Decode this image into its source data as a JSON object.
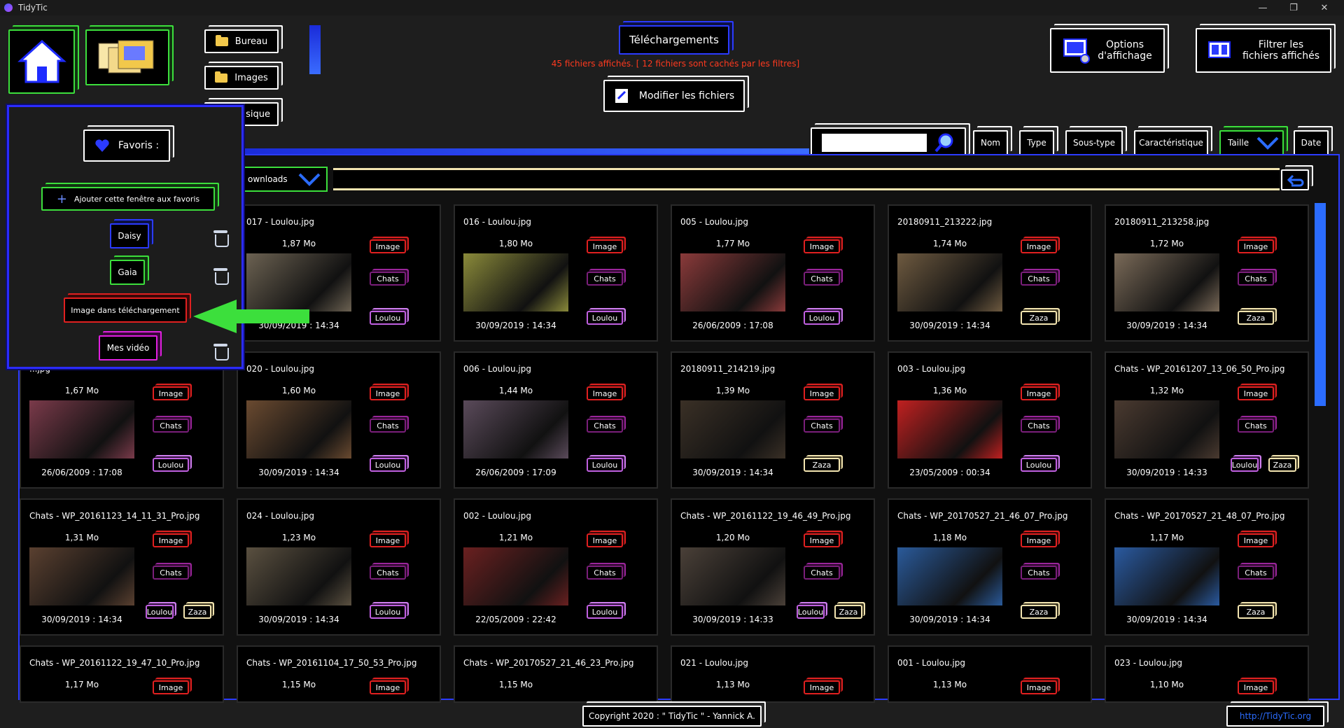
{
  "window": {
    "title": "TidyTic",
    "controls": [
      "—",
      "❐",
      "✕"
    ]
  },
  "nav": {
    "bureau": "Bureau",
    "images": "Images",
    "musique": "usique"
  },
  "header": {
    "location": "Téléchargements",
    "count_text": "45 fichiers affichés. [ 12 fichiers sont cachés par les filtres]",
    "modify_label": "Modifier les fichiers",
    "options_label": "Options\nd'affichage",
    "filter_label": "Filtrer les\nfichiers affichés"
  },
  "sort": {
    "nom": "Nom",
    "type": "Type",
    "soustype": "Sous-type",
    "carac": "Caractéristique",
    "taille": "Taille",
    "date": "Date"
  },
  "search": {
    "placeholder": ""
  },
  "path": {
    "text": "ownloads"
  },
  "favorites": {
    "title": "Favoris :",
    "add_label": "Ajouter cette fenêtre aux favoris",
    "items": [
      {
        "label": "Daisy",
        "color": "#2b3bff"
      },
      {
        "label": "Gaia",
        "color": "#3cdf3c"
      },
      {
        "label": "Image dans téléchargement",
        "color": "#e02020"
      },
      {
        "label": "Mes vidéo",
        "color": "#e020e0"
      }
    ]
  },
  "files": [
    {
      "name": "017 - Loulou.jpg",
      "size": "1,87 Mo",
      "date": "30/09/2019 : 14:34",
      "tags": [
        "Image",
        "Chats",
        "Loulou"
      ],
      "thumb": "#6c6252"
    },
    {
      "name": "016 - Loulou.jpg",
      "size": "1,80 Mo",
      "date": "30/09/2019 : 14:34",
      "tags": [
        "Image",
        "Chats",
        "Loulou"
      ],
      "thumb": "#8a8a3a"
    },
    {
      "name": "005 - Loulou.jpg",
      "size": "1,77 Mo",
      "date": "26/06/2009 : 17:08",
      "tags": [
        "Image",
        "Chats",
        "Loulou"
      ],
      "thumb": "#8a3a3a"
    },
    {
      "name": "20180911_213222.jpg",
      "size": "1,74 Mo",
      "date": "30/09/2019 : 14:34",
      "tags": [
        "Image",
        "Chats",
        "Zaza"
      ],
      "thumb": "#6e5a40"
    },
    {
      "name": "20180911_213258.jpg",
      "size": "1,72 Mo",
      "date": "30/09/2019 : 14:34",
      "tags": [
        "Image",
        "Chats",
        "Zaza"
      ],
      "thumb": "#7a6a58"
    },
    {
      "name": "...jpg",
      "size": "1,67 Mo",
      "date": "26/06/2009 : 17:08",
      "tags": [
        "Image",
        "Chats",
        "Loulou"
      ],
      "thumb": "#7a3a4a"
    },
    {
      "name": "020 - Loulou.jpg",
      "size": "1,60 Mo",
      "date": "30/09/2019 : 14:34",
      "tags": [
        "Image",
        "Chats",
        "Loulou"
      ],
      "thumb": "#6a4a30"
    },
    {
      "name": "006 - Loulou.jpg",
      "size": "1,44 Mo",
      "date": "26/06/2009 : 17:09",
      "tags": [
        "Image",
        "Chats",
        "Loulou"
      ],
      "thumb": "#5a4a5a"
    },
    {
      "name": "20180911_214219.jpg",
      "size": "1,39 Mo",
      "date": "30/09/2019 : 14:34",
      "tags": [
        "Image",
        "Chats",
        "Zaza"
      ],
      "thumb": "#3a3026"
    },
    {
      "name": "003 - Loulou.jpg",
      "size": "1,36 Mo",
      "date": "23/05/2009 : 00:34",
      "tags": [
        "Image",
        "Chats",
        "Loulou"
      ],
      "thumb": "#c02020"
    },
    {
      "name": "Chats - WP_20161207_13_06_50_Pro.jpg",
      "size": "1,32 Mo",
      "date": "30/09/2019 : 14:33",
      "tags": [
        "Image",
        "Chats",
        "Loulou",
        "Zaza"
      ],
      "thumb": "#4a3a30"
    },
    {
      "name": "Chats - WP_20161123_14_11_31_Pro.jpg",
      "size": "1,31 Mo",
      "date": "30/09/2019 : 14:34",
      "tags": [
        "Image",
        "Chats",
        "Loulou",
        "Zaza"
      ],
      "thumb": "#5a4030"
    },
    {
      "name": "024 - Loulou.jpg",
      "size": "1,23 Mo",
      "date": "30/09/2019 : 14:34",
      "tags": [
        "Image",
        "Chats",
        "Loulou"
      ],
      "thumb": "#5a5040"
    },
    {
      "name": "002 - Loulou.jpg",
      "size": "1,21 Mo",
      "date": "22/05/2009 : 22:42",
      "tags": [
        "Image",
        "Chats",
        "Loulou"
      ],
      "thumb": "#6a2020"
    },
    {
      "name": "Chats - WP_20161122_19_46_49_Pro.jpg",
      "size": "1,20 Mo",
      "date": "30/09/2019 : 14:33",
      "tags": [
        "Image",
        "Chats",
        "Loulou",
        "Zaza"
      ],
      "thumb": "#4a4038"
    },
    {
      "name": "Chats - WP_20170527_21_46_07_Pro.jpg",
      "size": "1,18 Mo",
      "date": "30/09/2019 : 14:34",
      "tags": [
        "Image",
        "Chats",
        "Zaza"
      ],
      "thumb": "#2a5a9a"
    },
    {
      "name": "Chats - WP_20170527_21_48_07_Pro.jpg",
      "size": "1,17 Mo",
      "date": "30/09/2019 : 14:34",
      "tags": [
        "Image",
        "Chats",
        "Zaza"
      ],
      "thumb": "#2a5aa0"
    },
    {
      "name": "Chats - WP_20161122_19_47_10_Pro.jpg",
      "size": "1,17 Mo",
      "date": "",
      "tags": [
        "Image"
      ],
      "thumb": "#333"
    },
    {
      "name": "Chats - WP_20161104_17_50_53_Pro.jpg",
      "size": "1,15 Mo",
      "date": "",
      "tags": [
        "Image"
      ],
      "thumb": "#333"
    },
    {
      "name": "Chats - WP_20170527_21_46_23_Pro.jpg",
      "size": "1,15 Mo",
      "date": "",
      "tags": [],
      "thumb": "#333"
    },
    {
      "name": "021 - Loulou.jpg",
      "size": "1,13 Mo",
      "date": "",
      "tags": [
        "Image"
      ],
      "thumb": "#333"
    },
    {
      "name": "001 - Loulou.jpg",
      "size": "1,13 Mo",
      "date": "",
      "tags": [
        "Image"
      ],
      "thumb": "#333"
    },
    {
      "name": "023 - Loulou.jpg",
      "size": "1,10 Mo",
      "date": "",
      "tags": [
        "Image"
      ],
      "thumb": "#333"
    }
  ],
  "footer": {
    "copyright": "Copyright 2020 : \" TidyTic \" - Yannick A.",
    "link": "http://TidyTic.org"
  },
  "colors": {
    "accent": "#2b3bff",
    "green": "#3cdf3c",
    "red": "#e02020",
    "count": "#ff3a1f"
  }
}
